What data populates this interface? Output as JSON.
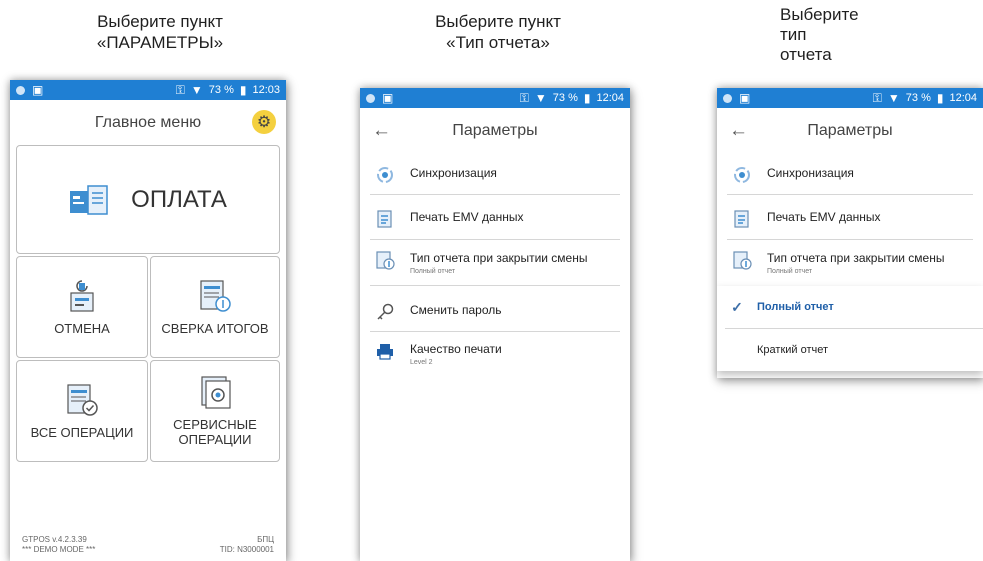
{
  "captions": {
    "step1": "Выберите пункт\n«ПАРАМЕТРЫ»",
    "step2": "Выберите пункт\n«Тип отчета»",
    "step3": "Выберите\nтип\nотчета"
  },
  "colors": {
    "statusbar": "#1f7fd3",
    "gear_bg": "#f4d03f",
    "selected_text": "#1f5fa8"
  },
  "screen1": {
    "status": {
      "battery": "73 %",
      "time": "12:03"
    },
    "title": "Главное меню",
    "tiles": {
      "pay": "ОПЛАТА",
      "cancel": "ОТМЕНА",
      "reconcile": "СВЕРКА ИТОГОВ",
      "all_ops": "ВСЕ ОПЕРАЦИИ",
      "service": "СЕРВИСНЫЕ\nОПЕРАЦИИ"
    },
    "footer": {
      "version": "GTPOS v.4.2.3.39",
      "demo": "*** DEMO MODE ***",
      "bank": "БПЦ",
      "tid": "TID: N3000001"
    }
  },
  "screen2": {
    "status": {
      "battery": "73 %",
      "time": "12:04"
    },
    "title": "Параметры",
    "items": [
      {
        "label": "Синхронизация",
        "sub": "",
        "icon": "sync-icon"
      },
      {
        "label": "Печать EMV данных",
        "sub": "",
        "icon": "document-icon"
      },
      {
        "label": "Тип отчета при закрытии смены",
        "sub": "Полный отчет",
        "icon": "report-icon"
      },
      {
        "label": "Сменить пароль",
        "sub": "",
        "icon": "key-icon"
      },
      {
        "label": "Качество печати",
        "sub": "Level 2",
        "icon": "printer-icon"
      }
    ]
  },
  "screen3": {
    "status": {
      "battery": "73 %",
      "time": "12:04"
    },
    "title": "Параметры",
    "items": [
      {
        "label": "Синхронизация",
        "sub": ""
      },
      {
        "label": "Печать EMV данных",
        "sub": ""
      },
      {
        "label": "Тип отчета при закрытии смены",
        "sub": "Полный отчет"
      }
    ],
    "options": [
      {
        "label": "Полный отчет",
        "selected": true
      },
      {
        "label": "Краткий отчет",
        "selected": false
      }
    ]
  }
}
